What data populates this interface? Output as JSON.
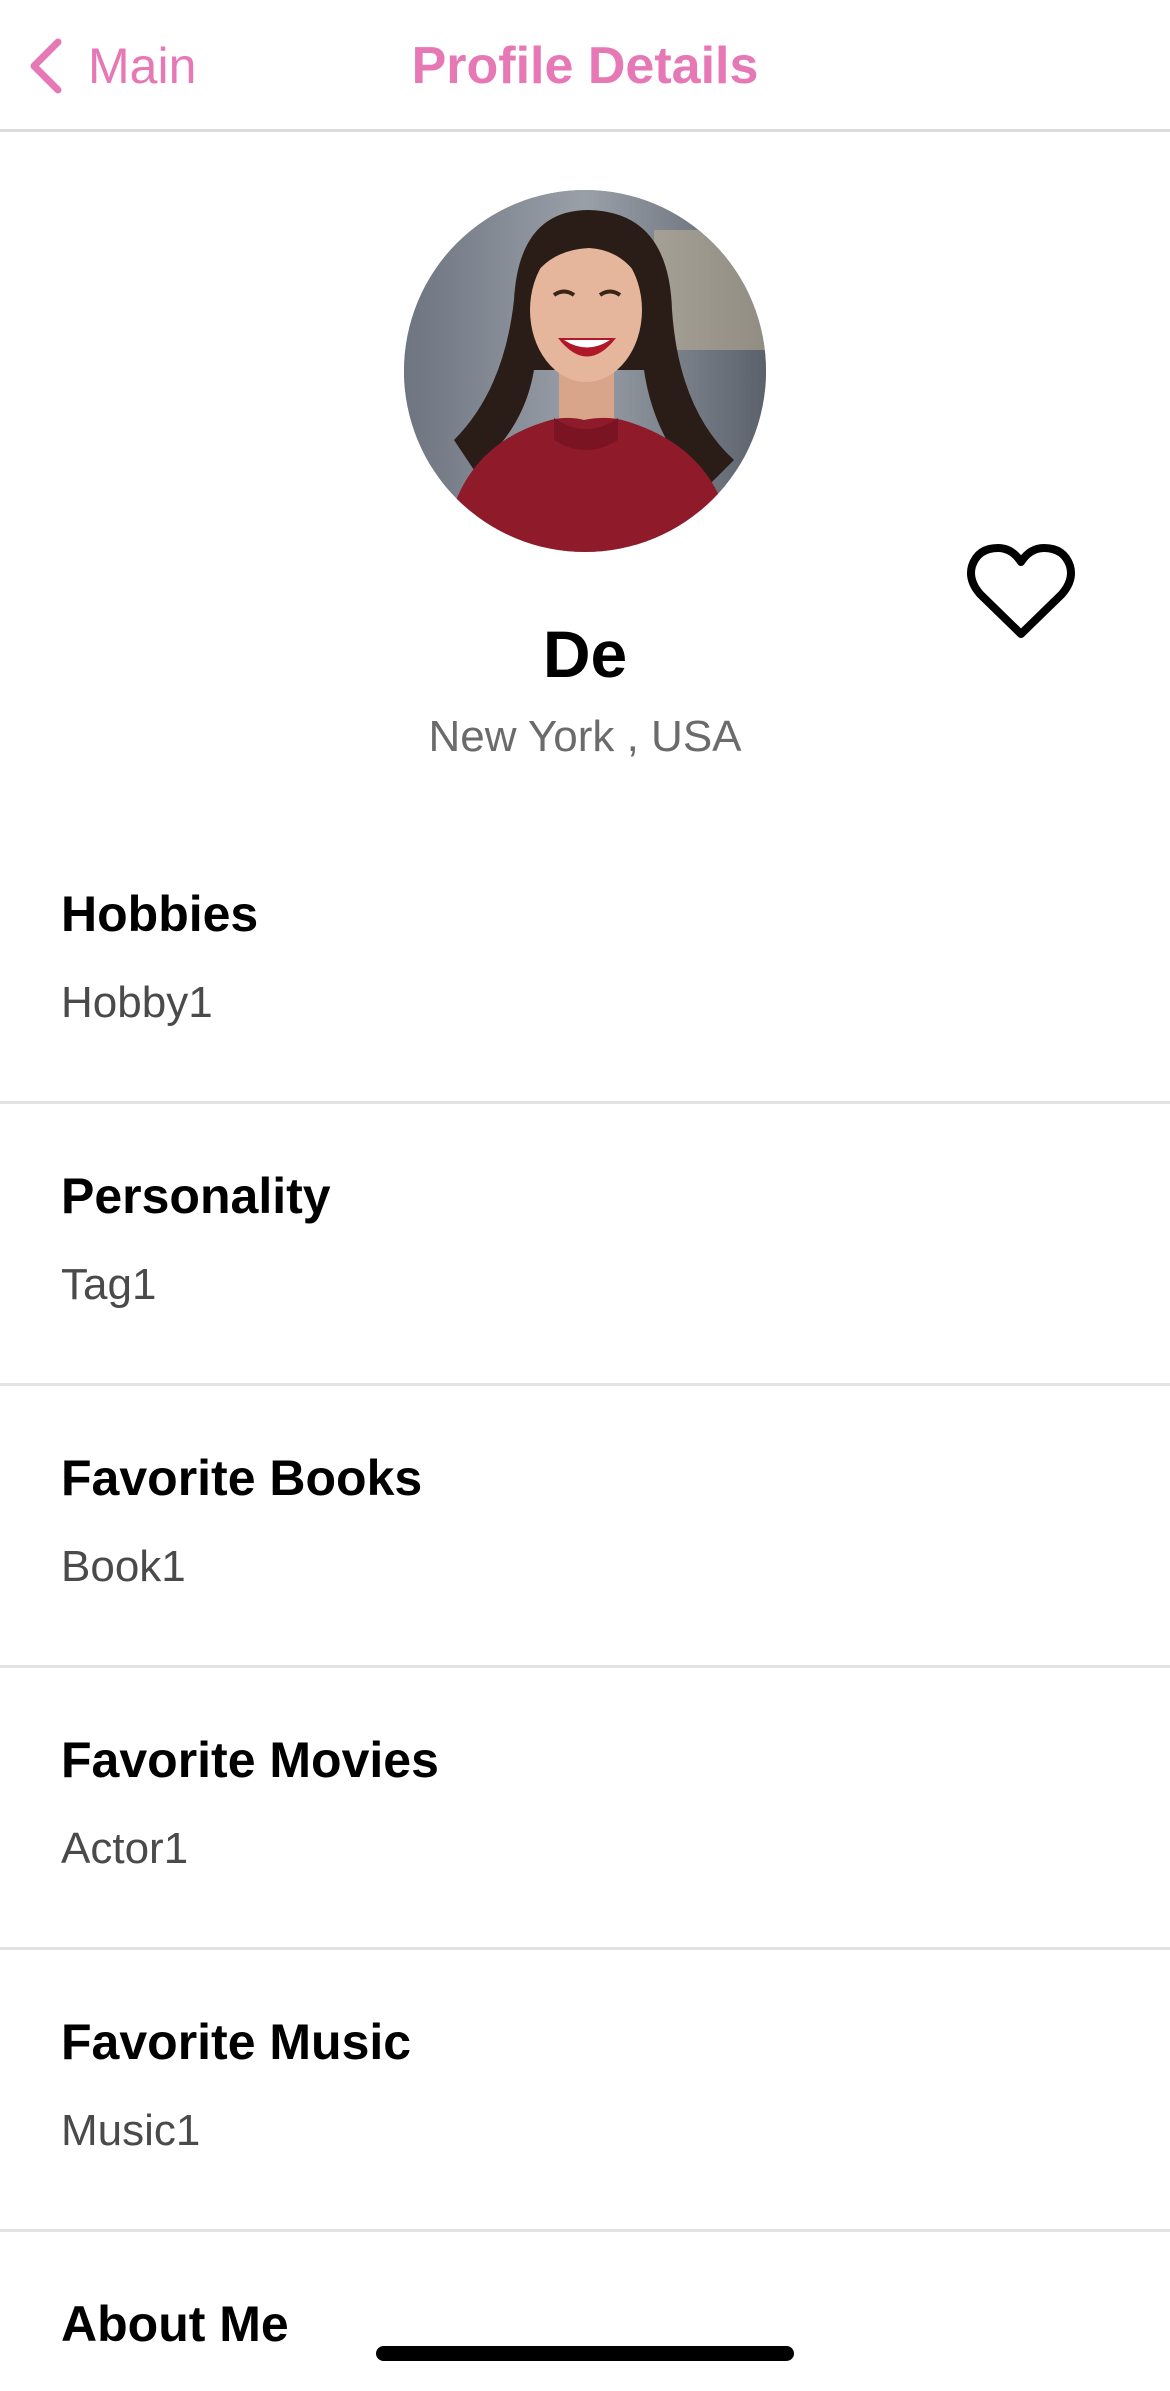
{
  "navbar": {
    "back_label": "Main",
    "title": "Profile Details",
    "accent_color": "#e678b6"
  },
  "profile": {
    "name": "De",
    "location": "New York , USA",
    "avatar_icon": "profile-photo",
    "favorite_icon": "heart-outline-icon"
  },
  "sections": [
    {
      "title": "Hobbies",
      "value": "Hobby1"
    },
    {
      "title": "Personality",
      "value": "Tag1"
    },
    {
      "title": "Favorite Books",
      "value": "Book1"
    },
    {
      "title": "Favorite Movies",
      "value": "Actor1"
    },
    {
      "title": "Favorite Music",
      "value": "Music1"
    },
    {
      "title": "About Me",
      "value": ""
    }
  ]
}
